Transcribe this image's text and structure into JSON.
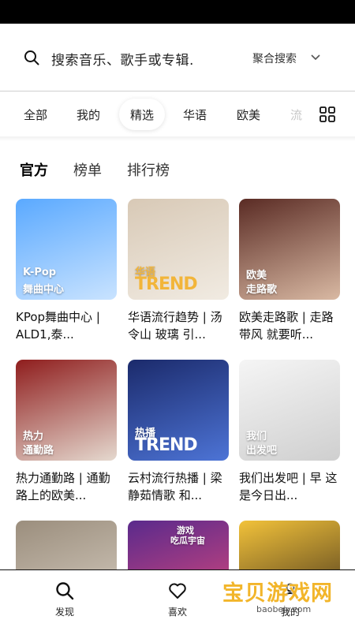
{
  "search": {
    "placeholder": "搜索音乐、歌手或专辑.",
    "mode_label": "聚合搜索"
  },
  "tabs": [
    {
      "label": "全部",
      "active": false
    },
    {
      "label": "我的",
      "active": false
    },
    {
      "label": "精选",
      "active": true
    },
    {
      "label": "华语",
      "active": false
    },
    {
      "label": "欧美",
      "active": false
    },
    {
      "label": "流",
      "active": false
    }
  ],
  "subtabs": [
    {
      "label": "官方",
      "active": true
    },
    {
      "label": "榜单",
      "active": false
    },
    {
      "label": "排行榜",
      "active": false
    }
  ],
  "playlists": [
    {
      "cover_line1": "K-Pop",
      "cover_line2": "舞曲中心",
      "title": "KPop舞曲中心 | ALD1,泰...",
      "colors": [
        "#5aa9ff",
        "#c9e3ff"
      ]
    },
    {
      "cover_line1": "华语",
      "cover_line2": "TREND",
      "title": "华语流行趋势 | 汤令山 玻璃 引...",
      "colors": [
        "#d8c9b6",
        "#f1ebe2"
      ]
    },
    {
      "cover_line1": "欧美",
      "cover_line2": "走路歌",
      "title": "欧美走路歌 | 走路带风 就要听...",
      "colors": [
        "#5a2b24",
        "#d9b9a3"
      ]
    },
    {
      "cover_line1": "热力",
      "cover_line2": "通勤路",
      "title": "热力通勤路 | 通勤路上的欧美...",
      "colors": [
        "#8f1d1d",
        "#e5d9cf"
      ]
    },
    {
      "cover_line1": "热播",
      "cover_line2": "TREND",
      "title": "云村流行热播 | 梁静茹情歌 和...",
      "colors": [
        "#1b2a6b",
        "#4d74d6"
      ]
    },
    {
      "cover_line1": "我们",
      "cover_line2": "出发吧",
      "title": "我们出发吧 | 早 这是今日出...",
      "colors": [
        "#f5f5f5",
        "#cfcfcf"
      ]
    },
    {
      "cover_line1": "",
      "cover_line2": "",
      "title": "",
      "colors": [
        "#9b8e7d",
        "#d8cfc3"
      ]
    },
    {
      "cover_line1": "游戏",
      "cover_line2": "吃瓜宇宙",
      "title": "",
      "colors": [
        "#5a2a8c",
        "#e04a7a"
      ]
    },
    {
      "cover_line1": "",
      "cover_line2": "",
      "title": "",
      "colors": [
        "#f2c23a",
        "#3a2a1a"
      ]
    }
  ],
  "bottom_nav": [
    {
      "label": "发现",
      "icon": "search-icon"
    },
    {
      "label": "喜欢",
      "icon": "heart-icon"
    },
    {
      "label": "我的",
      "icon": "user-icon"
    }
  ],
  "watermark": {
    "text": "宝贝游戏网",
    "url": "baobeiy.com"
  }
}
